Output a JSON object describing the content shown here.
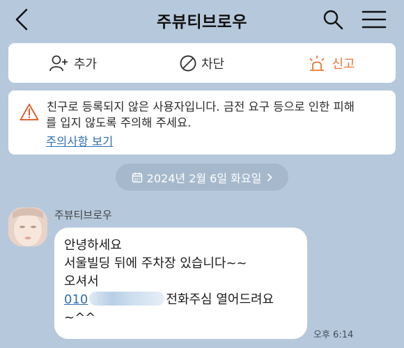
{
  "header": {
    "title": "주뷰티브로우"
  },
  "actions": {
    "add": "추가",
    "block": "차단",
    "report": "신고"
  },
  "notice": {
    "line1": "친구로 등록되지 않은 사용자입니다. 금전 요구 등으로 인한 피해",
    "line2": "를 입지 않도록 주의해 주세요.",
    "link": "주의사항 보기"
  },
  "date_divider": {
    "label": "2024년 2월 6일 화요일"
  },
  "message": {
    "sender": "주뷰티브로우",
    "line1": "안녕하세요",
    "line2": "서울빌딩 뒤에 주차장 있습니다~~",
    "line3": "오셔서",
    "phone_prefix": "010",
    "line4_suffix": "전화주심 열어드려요",
    "line5": "~^^",
    "time": "오후 6:14"
  },
  "colors": {
    "background": "#b6c9dc",
    "accent_report": "#e8752e",
    "link": "#2f6fb3"
  }
}
